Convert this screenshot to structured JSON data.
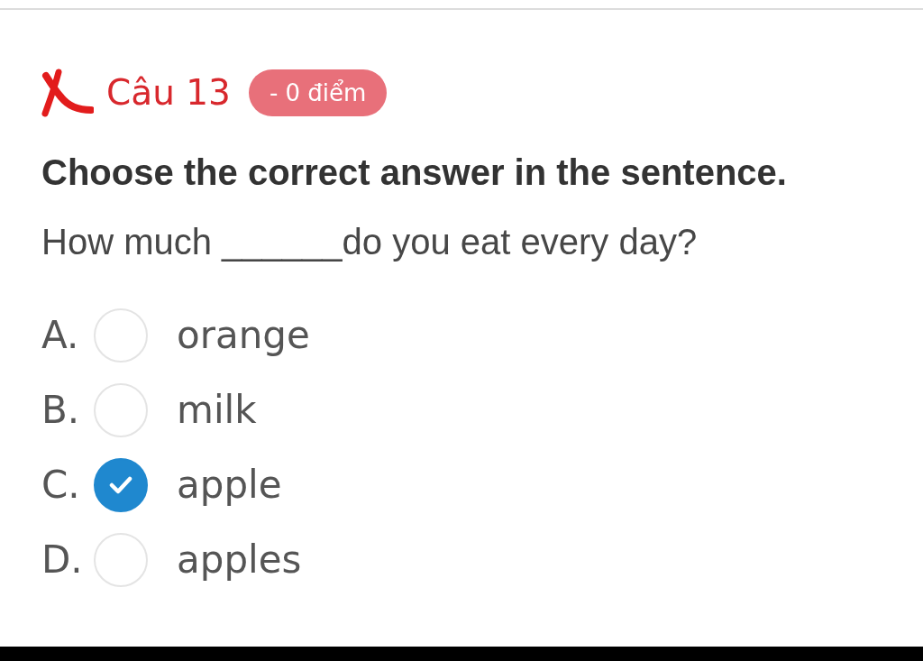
{
  "question": {
    "correct": false,
    "title": "Câu 13",
    "score_badge": "- 0 điểm",
    "instruction": "Choose the correct answer in the sentence.",
    "sentence": "How much ______do you eat every day?"
  },
  "options": [
    {
      "letter": "A.",
      "text": "orange",
      "selected": false
    },
    {
      "letter": "B.",
      "text": "milk",
      "selected": false
    },
    {
      "letter": "C.",
      "text": "apple",
      "selected": true
    },
    {
      "letter": "D.",
      "text": "apples",
      "selected": false
    }
  ]
}
